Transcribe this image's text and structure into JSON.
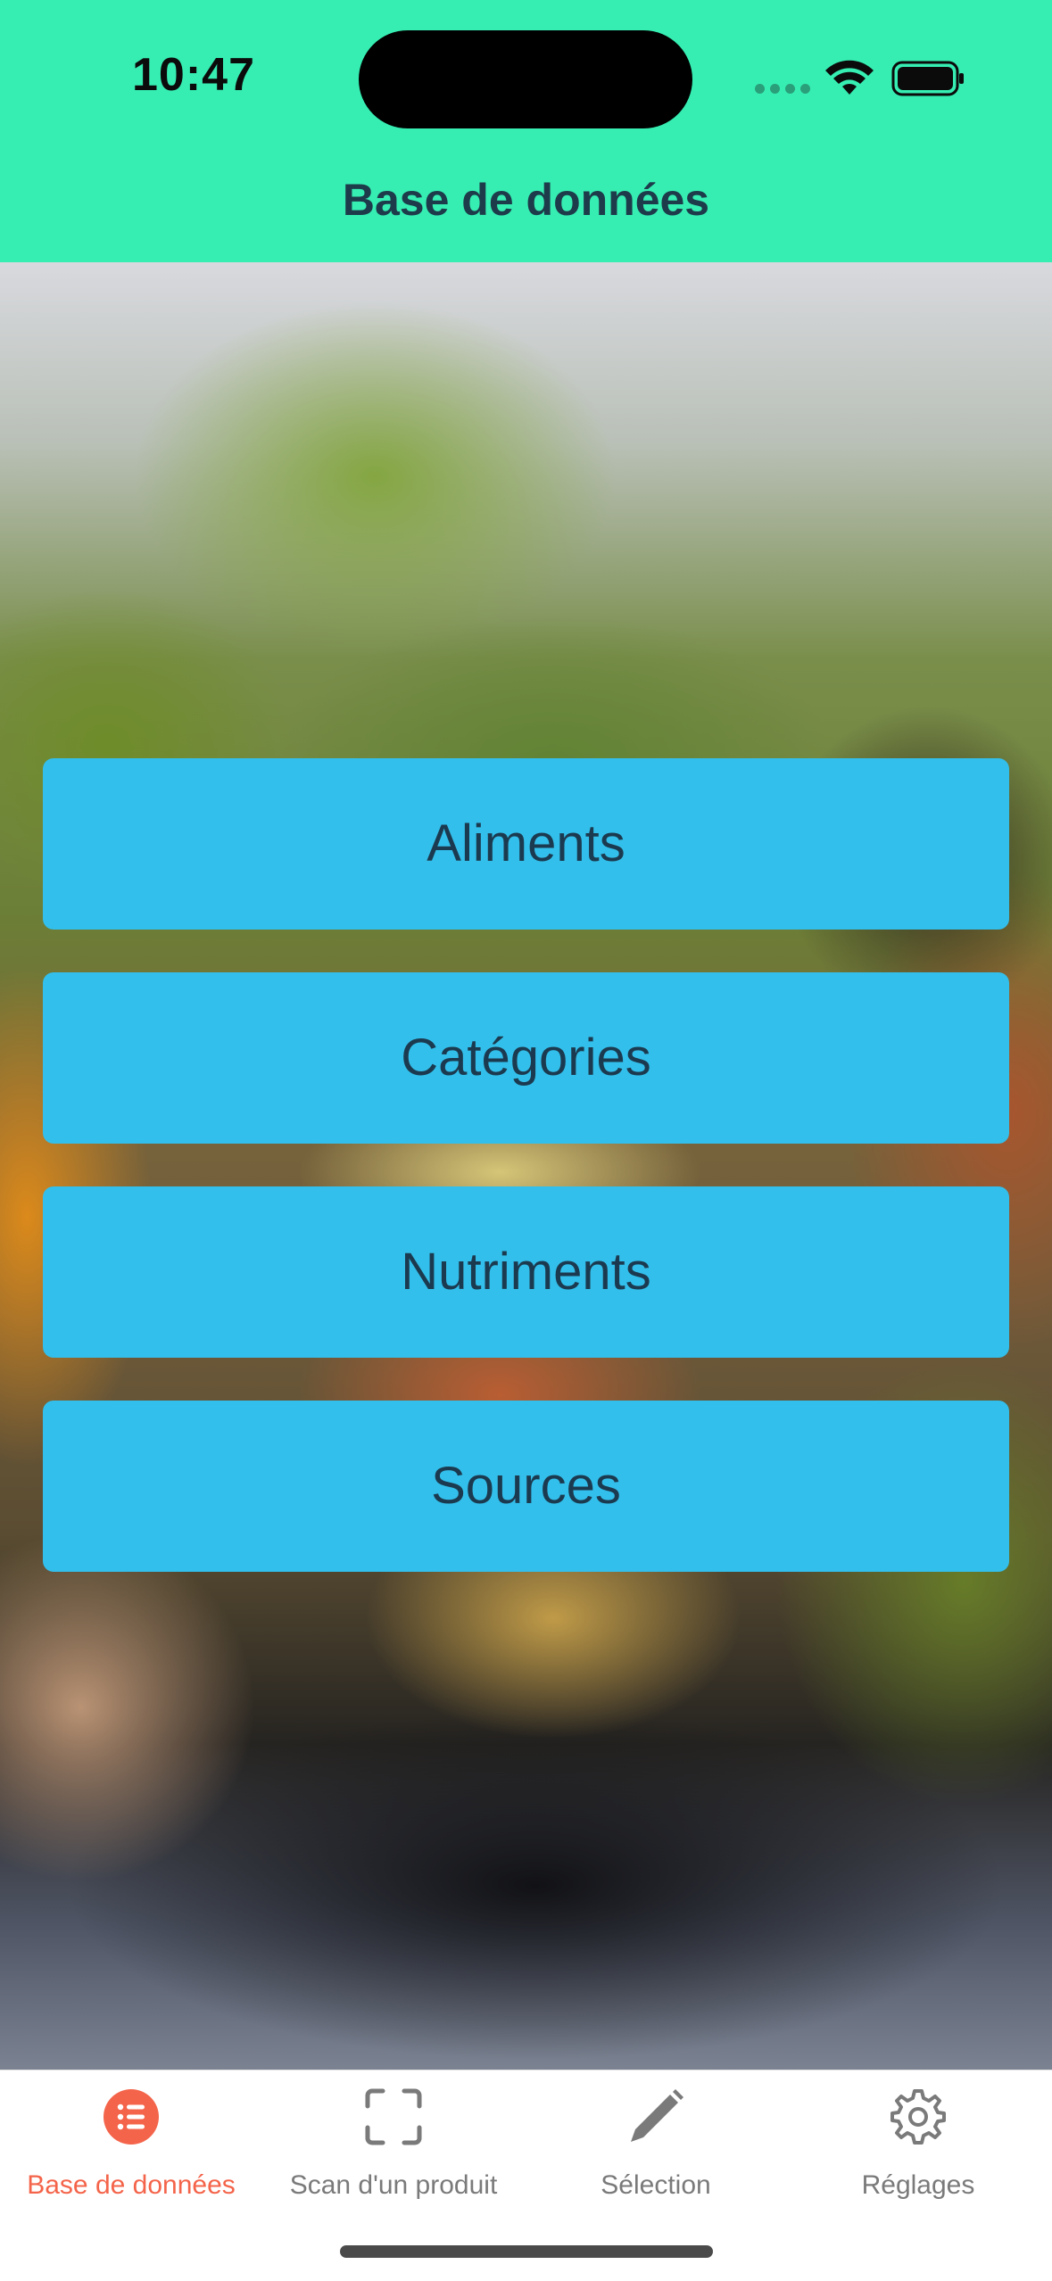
{
  "status_bar": {
    "time": "10:47",
    "icons": [
      "cellular-icon",
      "wifi-icon",
      "battery-icon"
    ]
  },
  "header": {
    "title": "Base de données"
  },
  "menu": {
    "items": [
      {
        "label": "Aliments"
      },
      {
        "label": "Catégories"
      },
      {
        "label": "Nutriments"
      },
      {
        "label": "Sources"
      }
    ]
  },
  "tabbar": {
    "tabs": [
      {
        "label": "Base de données",
        "icon": "list-icon",
        "active": true
      },
      {
        "label": "Scan d'un produit",
        "icon": "scan-icon",
        "active": false
      },
      {
        "label": "Sélection",
        "icon": "pencil-icon",
        "active": false
      },
      {
        "label": "Réglages",
        "icon": "gear-icon",
        "active": false
      }
    ]
  },
  "colors": {
    "header_bg": "#36eeb2",
    "button_bg": "#33bfeb",
    "button_text": "#1c3a4f",
    "active_tab": "#f4644a",
    "inactive_tab": "#7a7a7a"
  }
}
